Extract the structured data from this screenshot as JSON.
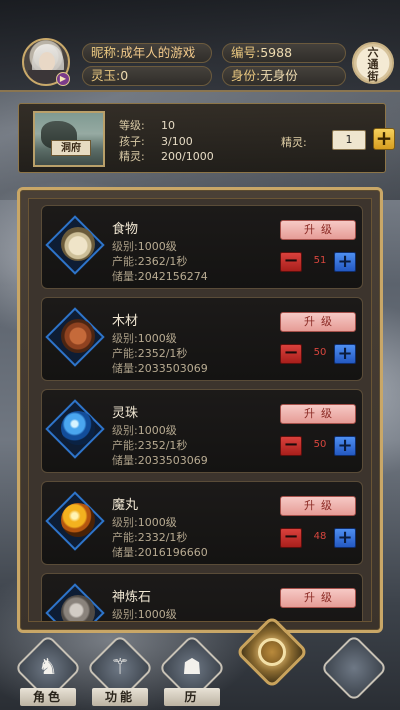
{
  "header": {
    "nickname_label": "昵称:",
    "nickname_value": "成年人的游戏",
    "id_label": "编号:",
    "id_value": "5988",
    "jade_label": "灵玉:",
    "jade_value": "0",
    "status_label": "身份:",
    "status_value": "无身份",
    "town_button": [
      "六",
      "通",
      "街"
    ],
    "avatar_badge": "▶"
  },
  "cave": {
    "thumb_label": "洞府",
    "level_label": "等级:",
    "level_value": "10",
    "children_label": "孩子:",
    "children_value": "3/100",
    "spirit_stat_label": "精灵:",
    "spirit_stat_value": "200/1000",
    "spirit_input_label": "精灵:",
    "spirit_input_value": "1",
    "plus_symbol": "+"
  },
  "resources": [
    {
      "name": "食物",
      "level_label": "级别:",
      "level": "1000级",
      "output_label": "产能:",
      "output": "2362/1秒",
      "stock_label": "储量:",
      "stock": "2042156274",
      "qty": "51",
      "upgrade": "升级",
      "icon": "rice-bag-icon",
      "icon_class": "ic-food"
    },
    {
      "name": "木材",
      "level_label": "级别:",
      "level": "1000级",
      "output_label": "产能:",
      "output": "2352/1秒",
      "stock_label": "储量:",
      "stock": "2033503069",
      "qty": "50",
      "upgrade": "升级",
      "icon": "log-pile-icon",
      "icon_class": "ic-wood"
    },
    {
      "name": "灵珠",
      "level_label": "级别:",
      "level": "1000级",
      "output_label": "产能:",
      "output": "2352/1秒",
      "stock_label": "储量:",
      "stock": "2033503069",
      "qty": "50",
      "upgrade": "升级",
      "icon": "spirit-pearl-icon",
      "icon_class": "ic-pearl"
    },
    {
      "name": "魔丸",
      "level_label": "级别:",
      "level": "1000级",
      "output_label": "产能:",
      "output": "2332/1秒",
      "stock_label": "储量:",
      "stock": "2016196660",
      "qty": "48",
      "upgrade": "升级",
      "icon": "demon-pill-icon",
      "icon_class": "ic-pill"
    },
    {
      "name": "神炼石",
      "level_label": "级别:",
      "level": "1000级",
      "output_label": "",
      "output": "",
      "stock_label": "",
      "stock": "",
      "qty": "",
      "upgrade": "升级",
      "icon": "refining-stone-icon",
      "icon_class": "ic-stone"
    }
  ],
  "controls": {
    "minus": "−",
    "plus": "+"
  },
  "nav": {
    "items": [
      {
        "label": "角色",
        "icon": "character-icon",
        "glyph": "♞"
      },
      {
        "label": "功能",
        "icon": "function-icon",
        "glyph": "⚚"
      },
      {
        "label": "历",
        "icon": "history-icon",
        "glyph": "☗"
      }
    ],
    "center_icon": "cave-home-icon"
  }
}
